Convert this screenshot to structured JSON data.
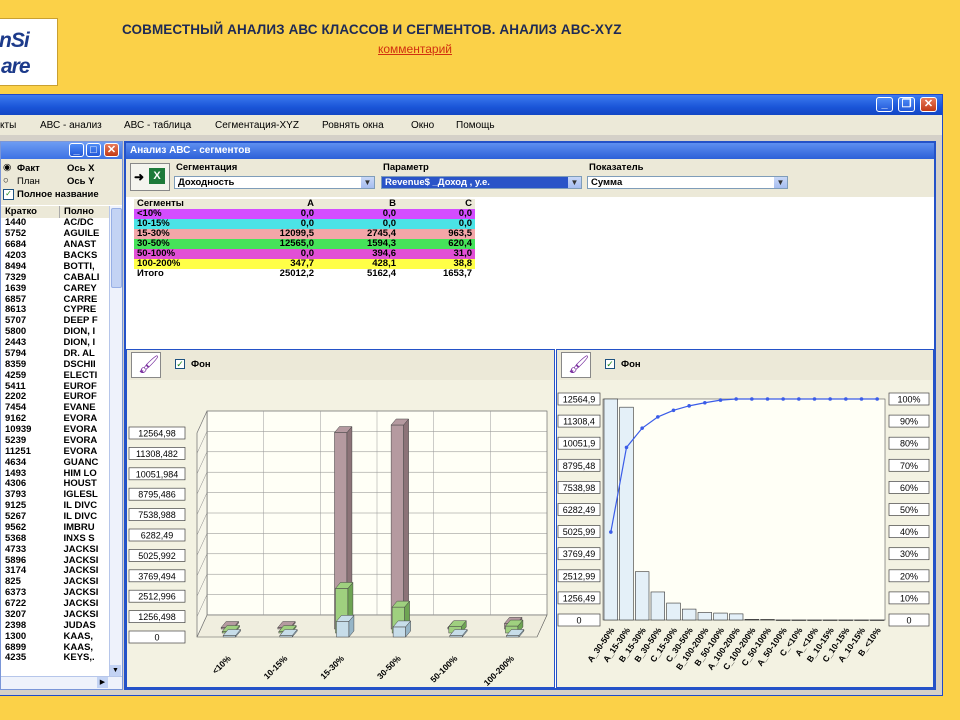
{
  "header": {
    "logo_line1": "nSi",
    "logo_line2": "are",
    "title": "СОВМЕСТНЫЙ АНАЛИЗ АВС КЛАССОВ И СЕГМЕНТОВ.   АНАЛИЗ ABC-XYZ",
    "comment_link": "комментарий"
  },
  "menu": [
    "кты",
    "АВС - анализ",
    "АВС - таблица",
    "Сегментация-XYZ",
    "Ровнять окна",
    "Окно",
    "Помощь"
  ],
  "left_panel": {
    "opt_fact": "Факт",
    "opt_plan": "План",
    "axis_x": "Ось X",
    "axis_y": "Ось Y",
    "full_name": "Полное название",
    "col_short": "Кратко",
    "col_full": "Полно",
    "rows": [
      [
        "1440",
        "AC/DC"
      ],
      [
        "5752",
        "AGUILE"
      ],
      [
        "6684",
        "ANAST"
      ],
      [
        "4203",
        "BACKS"
      ],
      [
        "8494",
        "BOTTI,"
      ],
      [
        "7329",
        "CABALI"
      ],
      [
        "1639",
        "CAREY"
      ],
      [
        "6857",
        "CARRE"
      ],
      [
        "8613",
        "CYPRE"
      ],
      [
        "5707",
        "DEEP F"
      ],
      [
        "5800",
        "DION, I"
      ],
      [
        "2443",
        "DION, I"
      ],
      [
        "5794",
        "DR. AL"
      ],
      [
        "8359",
        "DSCHII"
      ],
      [
        "4259",
        "ELECTI"
      ],
      [
        "5411",
        "EUROF"
      ],
      [
        "2202",
        "EUROF"
      ],
      [
        "7454",
        "EVANE"
      ],
      [
        "9162",
        "EVORA"
      ],
      [
        "10939",
        "EVORA"
      ],
      [
        "5239",
        "EVORA"
      ],
      [
        "11251",
        "EVORA"
      ],
      [
        "4634",
        "GUANC"
      ],
      [
        "1493",
        "HIM LO"
      ],
      [
        "4306",
        "HOUST"
      ],
      [
        "3793",
        "IGLESL"
      ],
      [
        "9125",
        "IL DIVC"
      ],
      [
        "5267",
        "IL DIVC"
      ],
      [
        "9562",
        "IMBRU"
      ],
      [
        "5368",
        "INXS S"
      ],
      [
        "4733",
        "JACKSI"
      ],
      [
        "5896",
        "JACKSI"
      ],
      [
        "3174",
        "JACKSI"
      ],
      [
        "825",
        "JACKSI"
      ],
      [
        "6373",
        "JACKSI"
      ],
      [
        "6722",
        "JACKSI"
      ],
      [
        "3207",
        "JACKSI"
      ],
      [
        "2398",
        "JUDAS"
      ],
      [
        "1300",
        "KAAS,"
      ],
      [
        "6899",
        "KAAS,"
      ],
      [
        "4235",
        "KEYS,."
      ]
    ]
  },
  "abc_window": {
    "title": "Анализ АВС - сегментов",
    "seg_label": "Сегментация",
    "seg_value": "Доходность",
    "param_label": "Параметр",
    "param_value": "Revenue$  _Доход , у.е.",
    "ind_label": "Показатель",
    "ind_value": "Сумма",
    "table_headers": [
      "Сегменты",
      "A",
      "B",
      "C"
    ],
    "rows": [
      {
        "seg": "<10%",
        "a": "0,0",
        "b": "0,0",
        "c": "0,0",
        "color": "#d44cff"
      },
      {
        "seg": "10-15%",
        "a": "0,0",
        "b": "0,0",
        "c": "0,0",
        "color": "#4be3e6"
      },
      {
        "seg": "15-30%",
        "a": "12099,5",
        "b": "2745,4",
        "c": "963,5",
        "color": "#f3a6a8"
      },
      {
        "seg": "30-50%",
        "a": "12565,0",
        "b": "1594,3",
        "c": "620,4",
        "color": "#46e35a"
      },
      {
        "seg": "50-100%",
        "a": "0,0",
        "b": "394,6",
        "c": "31,0",
        "color": "#e24fd6"
      },
      {
        "seg": "100-200%",
        "a": "347,7",
        "b": "428,1",
        "c": "38,8",
        "color": "#ffff47"
      },
      {
        "seg": "Итого",
        "a": "25012,2",
        "b": "5162,4",
        "c": "1653,7",
        "color": "#ffffff"
      }
    ],
    "fon_label": "Фон"
  },
  "chart_data": [
    {
      "type": "bar",
      "categories": [
        "<10%",
        "10-15%",
        "15-30%",
        "30-50%",
        "50-100%",
        "100-200%"
      ],
      "series": [
        {
          "name": "A",
          "values": [
            0,
            0,
            12099.5,
            12565.0,
            0,
            347.7
          ]
        },
        {
          "name": "B",
          "values": [
            0,
            0,
            2745.4,
            1594.3,
            394.6,
            428.1
          ]
        },
        {
          "name": "C",
          "values": [
            0,
            0,
            963.5,
            620.4,
            31.0,
            38.8
          ]
        }
      ],
      "yticks": [
        "0",
        "1256,498",
        "2512,996",
        "3769,494",
        "5025,992",
        "6282,49",
        "7538,988",
        "8795,486",
        "10051,984",
        "11308,482",
        "12564,98"
      ],
      "ylim": [
        0,
        12564.98
      ],
      "colors": {
        "A": "#b59aa0",
        "B": "#9fd07f",
        "C": "#c7dde9"
      }
    },
    {
      "type": "bar",
      "categories": [
        "A_30-50%",
        "A_15-30%",
        "B_15-30%",
        "B_30-50%",
        "C_15-30%",
        "C_30-50%",
        "B_100-200%",
        "B_50-100%",
        "A_100-200%",
        "C_100-200%",
        "C_50-100%",
        "A_50-100%",
        "C_<10%",
        "A_<10%",
        "B_10-15%",
        "C_10-15%",
        "A_10-15%",
        "B_<10%"
      ],
      "values": [
        12565.0,
        12099.5,
        2745.4,
        1594.3,
        963.5,
        620.4,
        428.1,
        394.6,
        347.7,
        38.8,
        31.0,
        0,
        0,
        0,
        0,
        0,
        0,
        0
      ],
      "cumulative_percent": [
        39.8,
        78.1,
        86.8,
        91.9,
        94.9,
        96.9,
        98.3,
        99.5,
        100,
        100,
        100,
        100,
        100,
        100,
        100,
        100,
        100,
        100
      ],
      "yticks": [
        "0",
        "1256,49",
        "2512,99",
        "3769,49",
        "5025,99",
        "6282,49",
        "7538,98",
        "8795,48",
        "10051,9",
        "11308,4",
        "12564,9"
      ],
      "y2ticks": [
        "0",
        "10%",
        "20%",
        "30%",
        "40%",
        "50%",
        "60%",
        "70%",
        "80%",
        "90%",
        "100%"
      ],
      "ylim": [
        0,
        12564.9
      ]
    }
  ]
}
